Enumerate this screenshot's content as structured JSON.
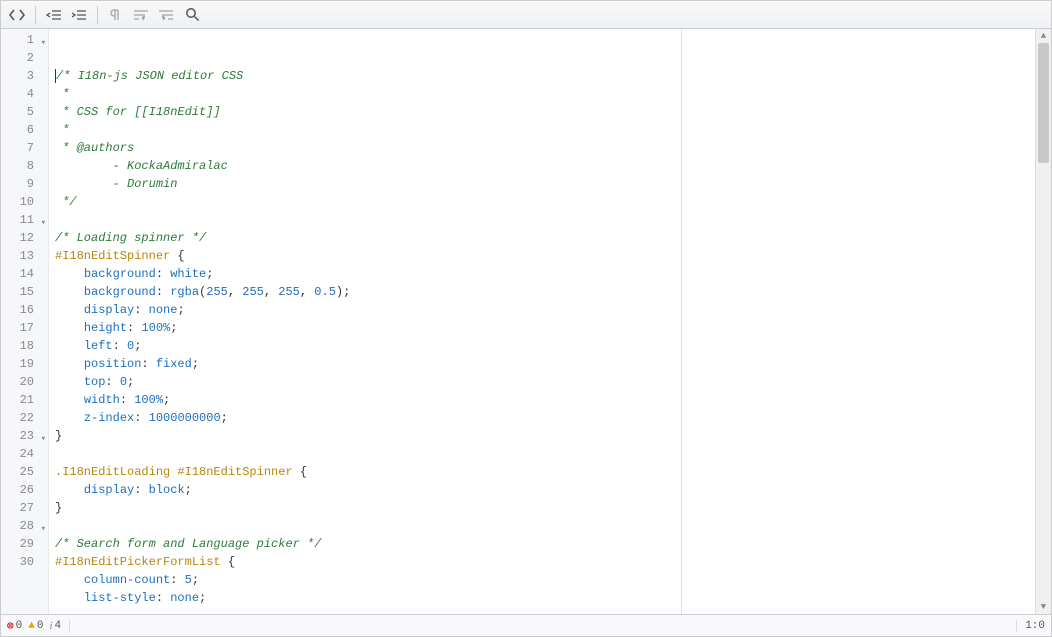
{
  "toolbar": {
    "buttons": [
      "toggle-code",
      "indent-left",
      "indent-right",
      "pilcrow",
      "wrap-para",
      "wrap-left",
      "search"
    ]
  },
  "gutter": {
    "lines": [
      {
        "n": 1,
        "fold": true
      },
      {
        "n": 2
      },
      {
        "n": 3
      },
      {
        "n": 4
      },
      {
        "n": 5
      },
      {
        "n": 6
      },
      {
        "n": 7
      },
      {
        "n": 8
      },
      {
        "n": 9
      },
      {
        "n": 10
      },
      {
        "n": 11,
        "fold": true
      },
      {
        "n": 12
      },
      {
        "n": 13
      },
      {
        "n": 14
      },
      {
        "n": 15
      },
      {
        "n": 16
      },
      {
        "n": 17
      },
      {
        "n": 18
      },
      {
        "n": 19
      },
      {
        "n": 20
      },
      {
        "n": 21
      },
      {
        "n": 22
      },
      {
        "n": 23,
        "fold": true
      },
      {
        "n": 24
      },
      {
        "n": 25
      },
      {
        "n": 26
      },
      {
        "n": 27
      },
      {
        "n": 28,
        "fold": true
      },
      {
        "n": 29
      },
      {
        "n": 30
      }
    ]
  },
  "code": [
    {
      "tokens": [
        {
          "cls": "c-comment",
          "t": "/* I18n-js JSON editor CSS"
        }
      ],
      "cursor_before": true
    },
    {
      "tokens": [
        {
          "cls": "c-comment",
          "t": " *"
        }
      ]
    },
    {
      "tokens": [
        {
          "cls": "c-comment",
          "t": " * CSS for [[I18nEdit]]"
        }
      ]
    },
    {
      "tokens": [
        {
          "cls": "c-comment",
          "t": " *"
        }
      ]
    },
    {
      "tokens": [
        {
          "cls": "c-comment",
          "t": " * @authors"
        }
      ]
    },
    {
      "tokens": [
        {
          "cls": "c-comment",
          "t": "        - KockaAdmiralac"
        }
      ]
    },
    {
      "tokens": [
        {
          "cls": "c-comment",
          "t": "        - Dorumin"
        }
      ]
    },
    {
      "tokens": [
        {
          "cls": "c-comment",
          "t": " */"
        }
      ]
    },
    {
      "tokens": []
    },
    {
      "tokens": [
        {
          "cls": "c-comment",
          "t": "/* Loading spinner */"
        }
      ]
    },
    {
      "tokens": [
        {
          "cls": "c-selector",
          "t": "#I18nEditSpinner"
        },
        {
          "cls": "c-punct",
          "t": " "
        },
        {
          "cls": "c-brace",
          "t": "{"
        }
      ]
    },
    {
      "tokens": [
        {
          "cls": "",
          "t": "    "
        },
        {
          "cls": "c-prop",
          "t": "background"
        },
        {
          "cls": "c-colon",
          "t": ": "
        },
        {
          "cls": "c-val",
          "t": "white"
        },
        {
          "cls": "c-punct",
          "t": ";"
        }
      ]
    },
    {
      "tokens": [
        {
          "cls": "",
          "t": "    "
        },
        {
          "cls": "c-prop",
          "t": "background"
        },
        {
          "cls": "c-colon",
          "t": ": "
        },
        {
          "cls": "c-val",
          "t": "rgba"
        },
        {
          "cls": "c-punct",
          "t": "("
        },
        {
          "cls": "c-num",
          "t": "255"
        },
        {
          "cls": "c-punct",
          "t": ", "
        },
        {
          "cls": "c-num",
          "t": "255"
        },
        {
          "cls": "c-punct",
          "t": ", "
        },
        {
          "cls": "c-num",
          "t": "255"
        },
        {
          "cls": "c-punct",
          "t": ", "
        },
        {
          "cls": "c-num",
          "t": "0.5"
        },
        {
          "cls": "c-punct",
          "t": ");"
        }
      ]
    },
    {
      "tokens": [
        {
          "cls": "",
          "t": "    "
        },
        {
          "cls": "c-prop",
          "t": "display"
        },
        {
          "cls": "c-colon",
          "t": ": "
        },
        {
          "cls": "c-val",
          "t": "none"
        },
        {
          "cls": "c-punct",
          "t": ";"
        }
      ]
    },
    {
      "tokens": [
        {
          "cls": "",
          "t": "    "
        },
        {
          "cls": "c-prop",
          "t": "height"
        },
        {
          "cls": "c-colon",
          "t": ": "
        },
        {
          "cls": "c-num",
          "t": "100%"
        },
        {
          "cls": "c-punct",
          "t": ";"
        }
      ]
    },
    {
      "tokens": [
        {
          "cls": "",
          "t": "    "
        },
        {
          "cls": "c-prop",
          "t": "left"
        },
        {
          "cls": "c-colon",
          "t": ": "
        },
        {
          "cls": "c-num",
          "t": "0"
        },
        {
          "cls": "c-punct",
          "t": ";"
        }
      ]
    },
    {
      "tokens": [
        {
          "cls": "",
          "t": "    "
        },
        {
          "cls": "c-prop",
          "t": "position"
        },
        {
          "cls": "c-colon",
          "t": ": "
        },
        {
          "cls": "c-val",
          "t": "fixed"
        },
        {
          "cls": "c-punct",
          "t": ";"
        }
      ]
    },
    {
      "tokens": [
        {
          "cls": "",
          "t": "    "
        },
        {
          "cls": "c-prop",
          "t": "top"
        },
        {
          "cls": "c-colon",
          "t": ": "
        },
        {
          "cls": "c-num",
          "t": "0"
        },
        {
          "cls": "c-punct",
          "t": ";"
        }
      ]
    },
    {
      "tokens": [
        {
          "cls": "",
          "t": "    "
        },
        {
          "cls": "c-prop",
          "t": "width"
        },
        {
          "cls": "c-colon",
          "t": ": "
        },
        {
          "cls": "c-num",
          "t": "100%"
        },
        {
          "cls": "c-punct",
          "t": ";"
        }
      ]
    },
    {
      "tokens": [
        {
          "cls": "",
          "t": "    "
        },
        {
          "cls": "c-prop",
          "t": "z-index"
        },
        {
          "cls": "c-colon",
          "t": ": "
        },
        {
          "cls": "c-num",
          "t": "1000000000"
        },
        {
          "cls": "c-punct",
          "t": ";"
        }
      ]
    },
    {
      "tokens": [
        {
          "cls": "c-brace",
          "t": "}"
        }
      ]
    },
    {
      "tokens": []
    },
    {
      "tokens": [
        {
          "cls": "c-selector",
          "t": ".I18nEditLoading #I18nEditSpinner"
        },
        {
          "cls": "c-punct",
          "t": " "
        },
        {
          "cls": "c-brace",
          "t": "{"
        }
      ]
    },
    {
      "tokens": [
        {
          "cls": "",
          "t": "    "
        },
        {
          "cls": "c-prop",
          "t": "display"
        },
        {
          "cls": "c-colon",
          "t": ": "
        },
        {
          "cls": "c-val",
          "t": "block"
        },
        {
          "cls": "c-punct",
          "t": ";"
        }
      ]
    },
    {
      "tokens": [
        {
          "cls": "c-brace",
          "t": "}"
        }
      ]
    },
    {
      "tokens": []
    },
    {
      "tokens": [
        {
          "cls": "c-comment",
          "t": "/* Search form and Language picker */"
        }
      ]
    },
    {
      "tokens": [
        {
          "cls": "c-selector",
          "t": "#I18nEditPickerFormList"
        },
        {
          "cls": "c-punct",
          "t": " "
        },
        {
          "cls": "c-brace",
          "t": "{"
        }
      ]
    },
    {
      "tokens": [
        {
          "cls": "",
          "t": "    "
        },
        {
          "cls": "c-prop",
          "t": "column-count"
        },
        {
          "cls": "c-colon",
          "t": ": "
        },
        {
          "cls": "c-num",
          "t": "5"
        },
        {
          "cls": "c-punct",
          "t": ";"
        }
      ]
    },
    {
      "tokens": [
        {
          "cls": "",
          "t": "    "
        },
        {
          "cls": "c-prop",
          "t": "list-style"
        },
        {
          "cls": "c-colon",
          "t": ": "
        },
        {
          "cls": "c-val",
          "t": "none"
        },
        {
          "cls": "c-punct",
          "t": ";"
        }
      ]
    }
  ],
  "status": {
    "errors": "0",
    "warnings": "0",
    "info": "4",
    "cursor": "1:0"
  }
}
